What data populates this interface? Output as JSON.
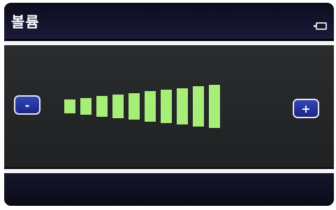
{
  "header": {
    "title": "볼륨",
    "battery_icon": "battery-icon"
  },
  "controls": {
    "decrease_label": "-",
    "increase_label": "+"
  },
  "volume": {
    "level": 10,
    "max": 10,
    "bar_color": "#a6ee78"
  },
  "colors": {
    "panel": "#26282a",
    "header": "#12132a",
    "button": "#2a3aa8",
    "rule": "#f4f4f6"
  }
}
